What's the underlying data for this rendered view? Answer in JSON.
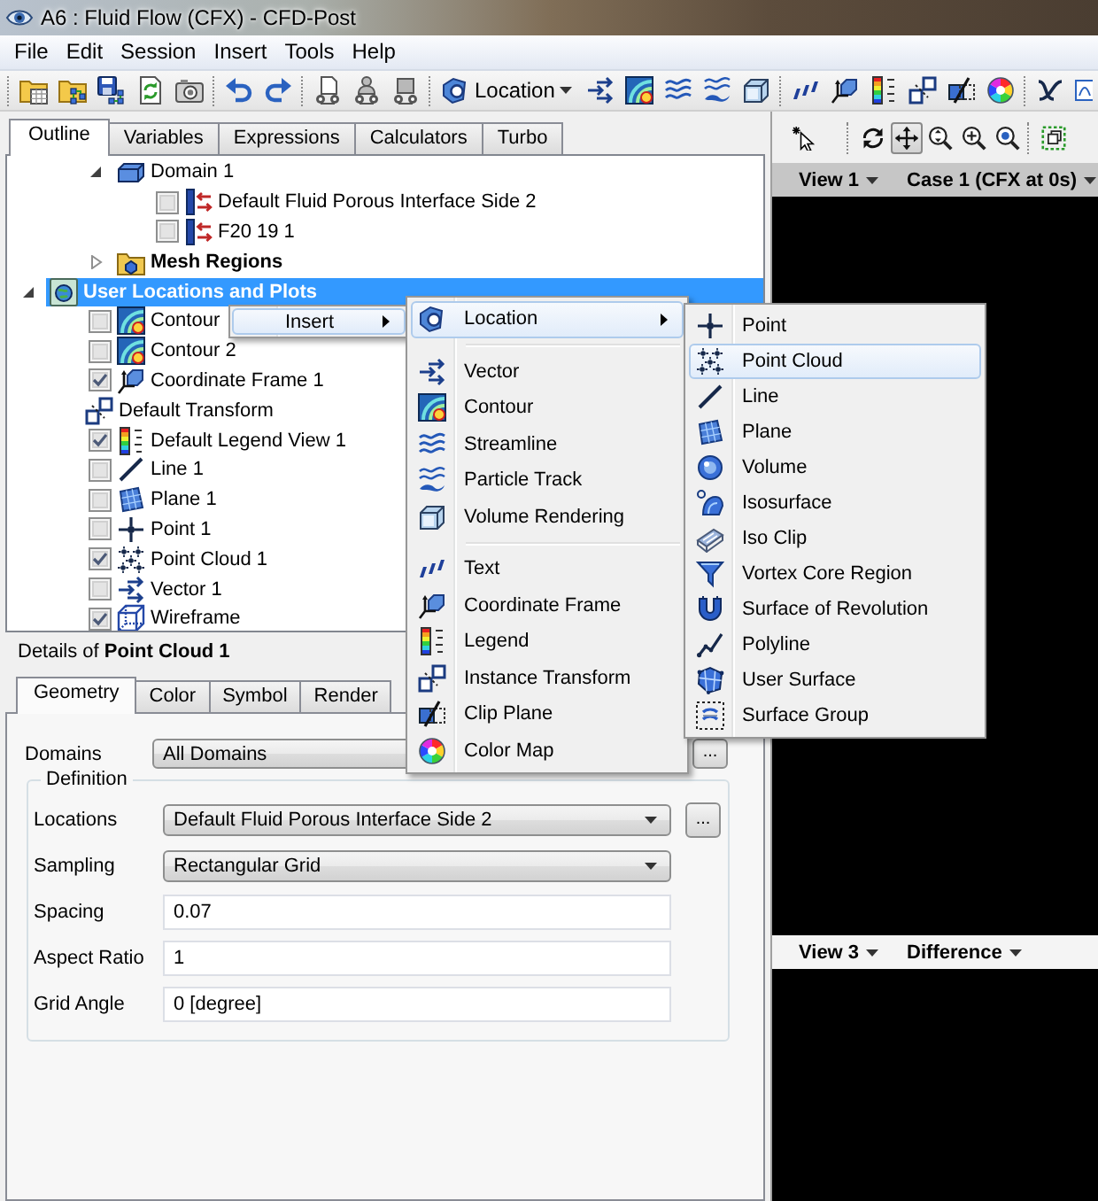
{
  "window": {
    "title": "A6 : Fluid Flow (CFX) - CFD-Post"
  },
  "menu_bar": [
    "File",
    "Edit",
    "Session",
    "Insert",
    "Tools",
    "Help"
  ],
  "toolbar": {
    "location_button": "Location"
  },
  "outline_tabs": [
    {
      "label": "Outline",
      "selected": true
    },
    {
      "label": "Variables",
      "selected": false
    },
    {
      "label": "Expressions",
      "selected": false
    },
    {
      "label": "Calculators",
      "selected": false
    },
    {
      "label": "Turbo",
      "selected": false
    }
  ],
  "tree": [
    {
      "children": [
        {
          "label": "Domain 1",
          "kind": "domain",
          "expanded": true,
          "selected": false,
          "children": [
            {
              "label": "Default Fluid Porous Interface Side 2",
              "kind": "interface",
              "checked": false,
              "selected": false
            },
            {
              "label": "F20 19 1",
              "kind": "interface",
              "checked": false,
              "selected": false
            }
          ]
        },
        {
          "label": "Mesh Regions",
          "kind": "mesh_regions",
          "expanded": false,
          "selected": false
        }
      ]
    },
    {
      "label": "User Locations and Plots",
      "kind": "user_locations",
      "expanded": true,
      "selected": true,
      "children": [
        {
          "label": "Contour",
          "kind": "contour",
          "checked": false,
          "selected": false
        },
        {
          "label": "Contour 2",
          "kind": "contour",
          "checked": false,
          "selected": false
        },
        {
          "label": "Coordinate Frame 1",
          "kind": "coordinate_frame",
          "checked": true,
          "selected": false
        },
        {
          "label": "Default Transform",
          "kind": "instance_transform",
          "selected": false
        },
        {
          "label": "Default Legend View 1",
          "kind": "legend",
          "checked": true,
          "selected": false
        },
        {
          "label": "Line 1",
          "kind": "line",
          "checked": false,
          "selected": false
        },
        {
          "label": "Plane 1",
          "kind": "plane",
          "checked": false,
          "selected": false
        },
        {
          "label": "Point 1",
          "kind": "point",
          "checked": false,
          "selected": false
        },
        {
          "label": "Point Cloud 1",
          "kind": "point_cloud",
          "checked": true,
          "selected": false
        },
        {
          "label": "Vector 1",
          "kind": "vector",
          "checked": false,
          "selected": false
        },
        {
          "label": "Wireframe",
          "kind": "wireframe",
          "checked": true,
          "selected": false
        }
      ]
    }
  ],
  "context_menu": [
    {
      "label": "Insert",
      "submenu": true,
      "selected": true
    }
  ],
  "insert_menu": [
    [
      {
        "label": "Location",
        "kind": "location",
        "submenu": true,
        "selected": true
      }
    ],
    [
      {
        "label": "Vector",
        "kind": "vector",
        "submenu": false,
        "selected": false
      },
      {
        "label": "Contour",
        "kind": "contour",
        "submenu": false,
        "selected": false
      },
      {
        "label": "Streamline",
        "kind": "streamline",
        "submenu": false,
        "selected": false
      },
      {
        "label": "Particle Track",
        "kind": "particle_track",
        "submenu": false,
        "selected": false
      },
      {
        "label": "Volume Rendering",
        "kind": "volume_rendering",
        "submenu": false,
        "selected": false
      }
    ],
    [
      {
        "label": "Text",
        "kind": "text",
        "submenu": false,
        "selected": false
      },
      {
        "label": "Coordinate Frame",
        "kind": "coordinate_frame",
        "submenu": false,
        "selected": false
      },
      {
        "label": "Legend",
        "kind": "legend",
        "submenu": false,
        "selected": false
      },
      {
        "label": "Instance Transform",
        "kind": "instance_transform",
        "submenu": false,
        "selected": false
      },
      {
        "label": "Clip Plane",
        "kind": "clip_plane",
        "submenu": false,
        "selected": false
      },
      {
        "label": "Color Map",
        "kind": "color_map",
        "submenu": false,
        "selected": false
      }
    ]
  ],
  "location_menu": [
    {
      "label": "Point",
      "kind": "point",
      "selected": false
    },
    {
      "label": "Point Cloud",
      "kind": "point_cloud",
      "selected": true
    },
    {
      "label": "Line",
      "kind": "line",
      "selected": false
    },
    {
      "label": "Plane",
      "kind": "plane",
      "selected": false
    },
    {
      "label": "Volume",
      "kind": "volume",
      "selected": false
    },
    {
      "label": "Isosurface",
      "kind": "isosurface",
      "selected": false
    },
    {
      "label": "Iso Clip",
      "kind": "iso_clip",
      "selected": false
    },
    {
      "label": "Vortex Core Region",
      "kind": "vortex_core",
      "selected": false
    },
    {
      "label": "Surface of Revolution",
      "kind": "surface_of_revolution",
      "selected": false
    },
    {
      "label": "Polyline",
      "kind": "polyline",
      "selected": false
    },
    {
      "label": "User Surface",
      "kind": "user_surface",
      "selected": false
    },
    {
      "label": "Surface Group",
      "kind": "surface_group",
      "selected": false
    }
  ],
  "details": {
    "title": "Details of **Point Cloud 1**",
    "tabs": [
      {
        "label": "Geometry",
        "selected": true
      },
      {
        "label": "Color",
        "selected": false
      },
      {
        "label": "Symbol",
        "selected": false
      },
      {
        "label": "Render",
        "selected": false
      }
    ],
    "domains": {
      "label": "Domains",
      "value": "All Domains",
      "button": "..."
    },
    "definition": {
      "title": "Definition",
      "fields": [
        {
          "label": "Locations",
          "kind": "dropdown",
          "value": "Default Fluid Porous Interface Side 2",
          "button": "..."
        },
        {
          "label": "Sampling",
          "kind": "dropdown",
          "value": "Rectangular Grid"
        },
        {
          "label": "Spacing",
          "kind": "text",
          "value": "0.07"
        },
        {
          "label": "Aspect Ratio",
          "kind": "text",
          "value": "1"
        },
        {
          "label": "Grid Angle",
          "kind": "text",
          "value": "0 [degree]"
        }
      ]
    }
  },
  "viewer_toolbar": [
    [
      {
        "kind": "pointer",
        "selected": false
      }
    ],
    [
      {
        "kind": "rotate",
        "selected": false
      },
      {
        "kind": "pan",
        "selected": true
      },
      {
        "kind": "zoom_box",
        "selected": false
      },
      {
        "kind": "zoom",
        "selected": false
      },
      {
        "kind": "zoom_fit",
        "selected": false
      }
    ],
    [
      {
        "kind": "frame",
        "selected": false
      }
    ]
  ],
  "viewports": [
    {
      "view": "View 1",
      "case": "Case 1 (CFX at 0s)",
      "active": true
    },
    {
      "view": "View 3",
      "case": "Difference",
      "active": false
    }
  ]
}
